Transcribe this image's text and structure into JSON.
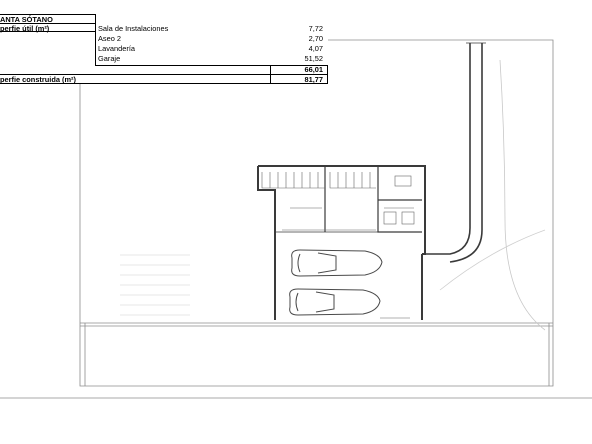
{
  "table": {
    "title": "ANTA SÓTANO",
    "useful_label": "perfie útil (m²)",
    "rooms": [
      {
        "name": "Sala de Instalaciones",
        "value": "7,72"
      },
      {
        "name": "Aseo 2",
        "value": "2,70"
      },
      {
        "name": "Lavandería",
        "value": "4,07"
      },
      {
        "name": "Garaje",
        "value": "51,52"
      }
    ],
    "useful_total": "66,01",
    "built_label": "perfie construida (m²)",
    "built_total": "81,77"
  },
  "plan": {
    "line_color": "#8c8c8c",
    "wall_color": "#3a3a3a"
  }
}
